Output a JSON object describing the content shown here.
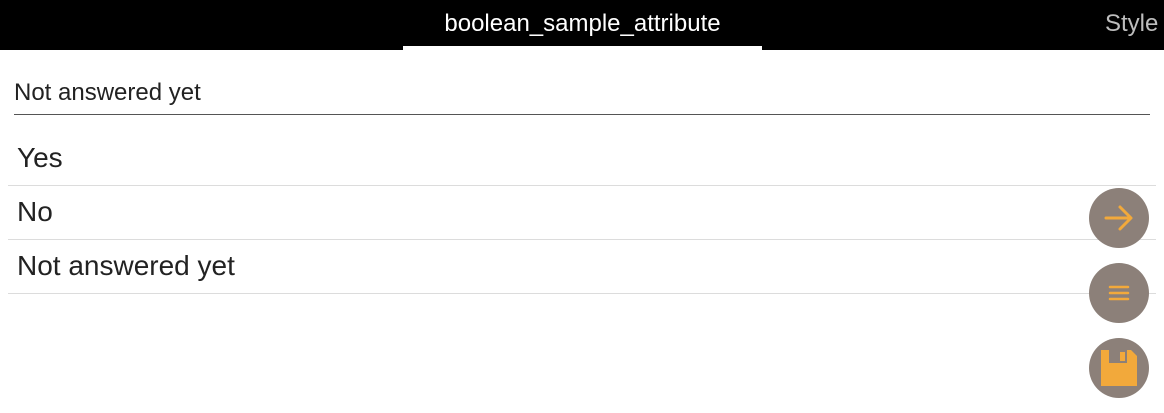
{
  "tabs": {
    "active_label": "boolean_sample_attribute",
    "next_label": "Style"
  },
  "field": {
    "value": "Not answered yet"
  },
  "options": [
    {
      "label": "Yes"
    },
    {
      "label": "No"
    },
    {
      "label": "Not answered yet"
    }
  ],
  "fabs": {
    "next_icon": "arrow-right-icon",
    "menu_icon": "list-icon",
    "save_icon": "floppy-disk-icon"
  },
  "colors": {
    "fab_background": "#8c8079",
    "accent": "#f2a93b",
    "tabbar": "#000000"
  }
}
